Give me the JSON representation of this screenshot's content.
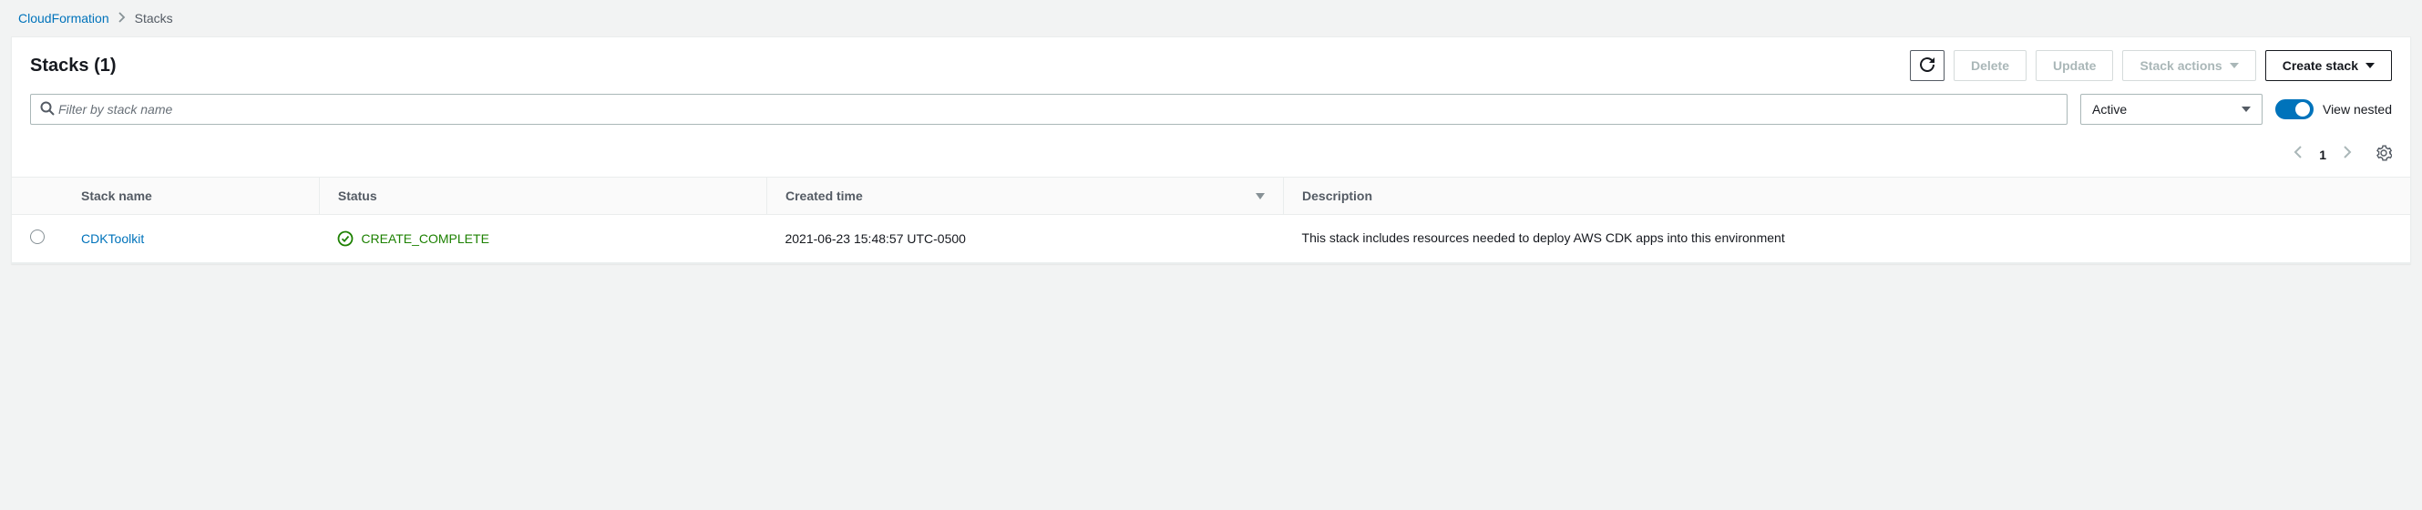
{
  "breadcrumb": {
    "root": "CloudFormation",
    "current": "Stacks"
  },
  "header": {
    "title": "Stacks",
    "count": "(1)"
  },
  "actions": {
    "delete": "Delete",
    "update": "Update",
    "stack_actions": "Stack actions",
    "create_stack": "Create stack"
  },
  "filter": {
    "placeholder": "Filter by stack name",
    "status_select": "Active",
    "view_nested": "View nested"
  },
  "pagination": {
    "current": "1"
  },
  "table": {
    "headers": {
      "stack_name": "Stack name",
      "status": "Status",
      "created_time": "Created time",
      "description": "Description"
    },
    "rows": [
      {
        "name": "CDKToolkit",
        "status": "CREATE_COMPLETE",
        "created": "2021-06-23 15:48:57 UTC-0500",
        "description": "This stack includes resources needed to deploy AWS CDK apps into this environment"
      }
    ]
  }
}
